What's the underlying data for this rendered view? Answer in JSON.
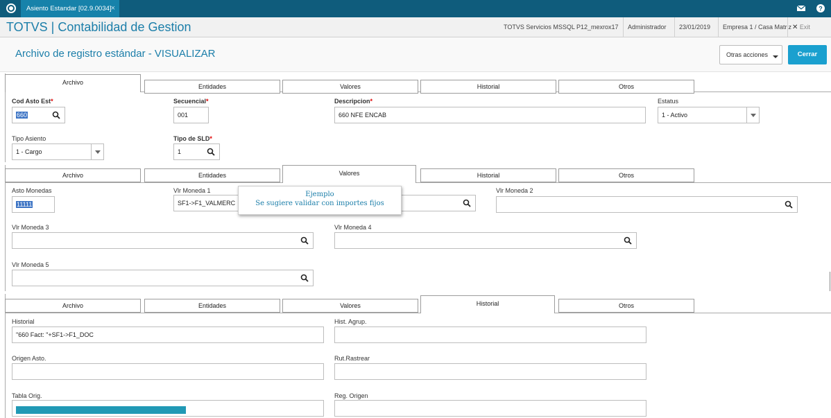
{
  "topbar": {
    "tab_label": "Asiento Estandar [02.9.0034]",
    "close_glyph": "×",
    "mail_icon": "mail-icon",
    "help_icon": "help-icon",
    "color": "#0f5c7c"
  },
  "titlebar": {
    "app_title": "TOTVS | Contabilidad de Gestion",
    "server": "TOTVS Servicios MSSQL P12_mexrox17",
    "user": "Administrador",
    "date": "23/01/2019",
    "company": "Empresa 1 / Casa Matriz",
    "exit_label": "Exit",
    "exit_glyph": "✕"
  },
  "page": {
    "title": "Archivo de registro estándar - VISUALIZAR",
    "more_actions": "Otras acciones",
    "close_button": "Cerrar",
    "accent": "#1aa0cf"
  },
  "tabs": [
    "Archivo",
    "Entidades",
    "Valores",
    "Historial",
    "Otros"
  ],
  "archivo": {
    "cod_label": "Cod Asto Est",
    "cod_value": "660",
    "sec_label": "Secuencial",
    "sec_value": "001",
    "desc_label": "Descripcion",
    "desc_value": "660 NFE ENCAB",
    "estatus_label": "Estatus",
    "estatus_value": "1 - Activo",
    "tipo_label": "Tipo Asiento",
    "tipo_value": "1 - Cargo",
    "sld_label": "Tipo de SLD",
    "sld_value": "1",
    "required_mark": "*"
  },
  "valores": {
    "asto_label": "Asto Monedas",
    "asto_value": "11111",
    "m1_label": "Vlr Moneda 1",
    "m1_value": "SF1->F1_VALMERC",
    "m2_label": "Vlr Moneda 2",
    "m2_value": "",
    "m3_label": "Vlr Moneda 3",
    "m3_value": "",
    "m4_label": "Vlr Moneda 4",
    "m4_value": "",
    "m5_label": "Vlr Moneda 5",
    "m5_value": "",
    "tooltip_title": "Ejemplo",
    "tooltip_text": "Se sugiere validar con importes fijos"
  },
  "historial": {
    "hist_label": "Historial",
    "hist_value": "\"660 Fact: \"+SF1->F1_DOC",
    "agrup_label": "Hist. Agrup.",
    "agrup_value": "",
    "origen_label": "Origen Asto.",
    "origen_value": "",
    "rut_label": "Rut.Rastrear",
    "rut_value": "",
    "tabla_label": "Tabla Orig.",
    "tabla_progress": 0.56,
    "reg_label": "Reg. Origen",
    "reg_value": ""
  }
}
